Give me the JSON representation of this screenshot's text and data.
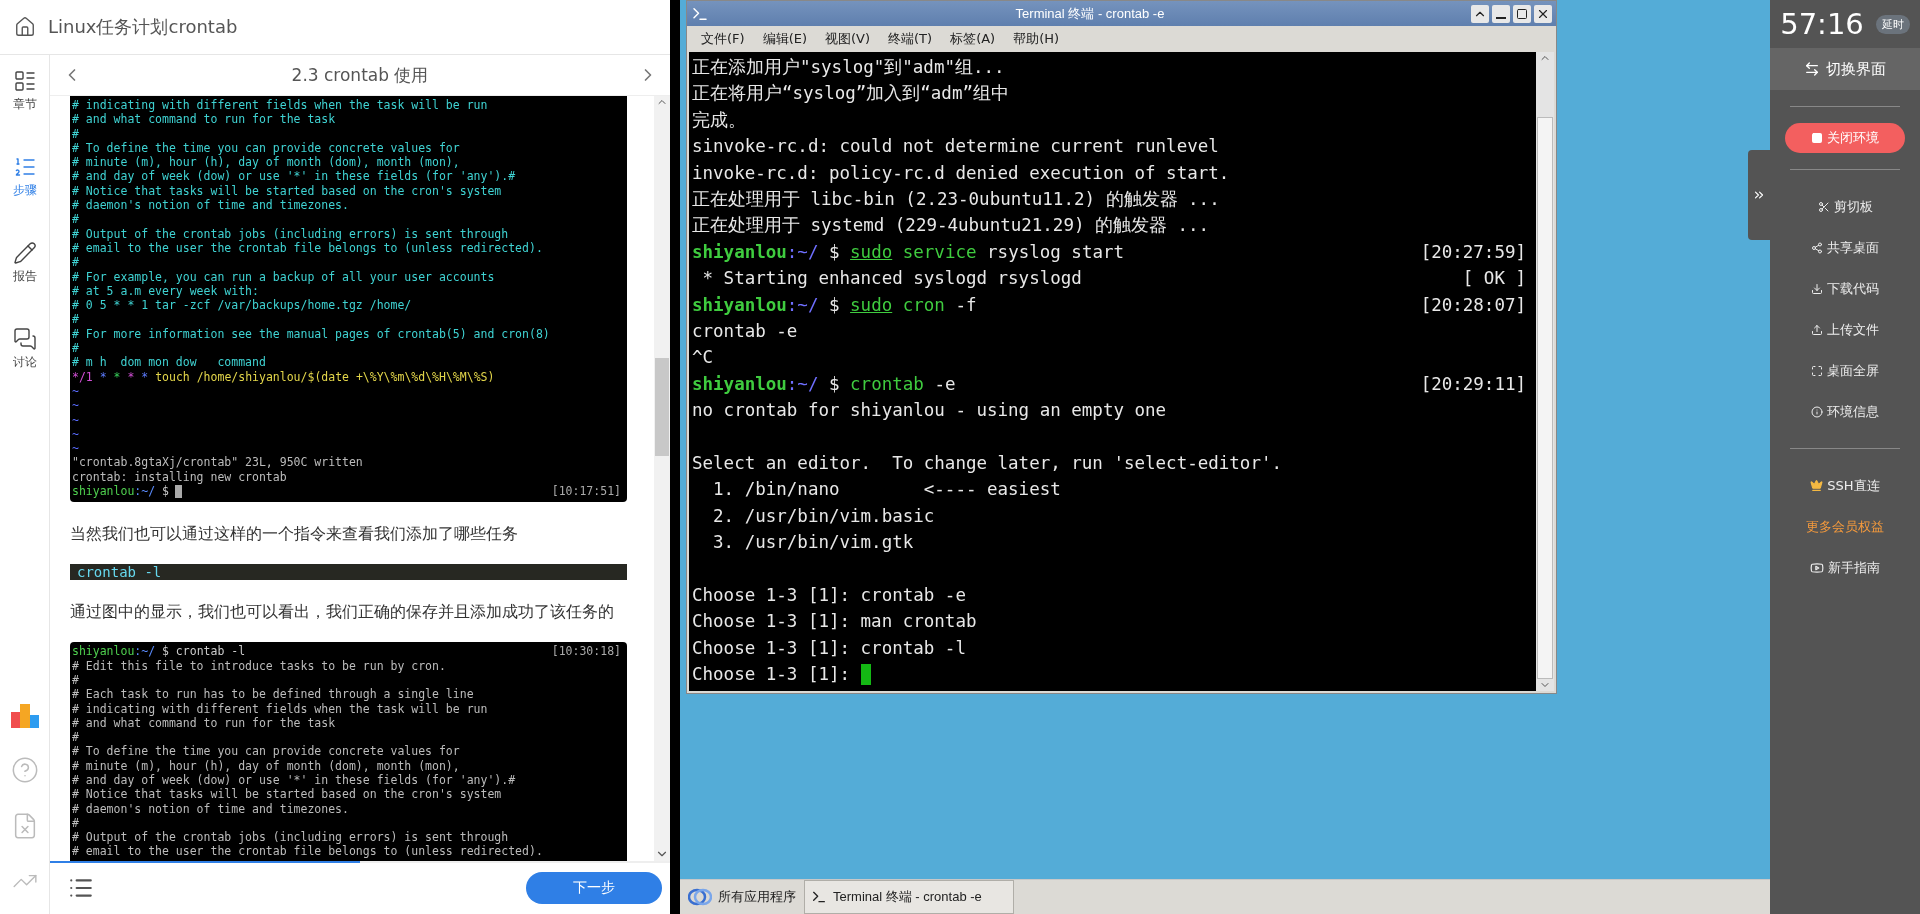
{
  "course": {
    "title": "Linux任务计划crontab"
  },
  "rail": {
    "items": [
      {
        "label": "章节",
        "selected": false
      },
      {
        "label": "步骤",
        "selected": true
      },
      {
        "label": "报告",
        "selected": false
      },
      {
        "label": "讨论",
        "selected": false
      }
    ]
  },
  "step": {
    "title": "2.3 crontab 使用"
  },
  "content": [
    {
      "kind": "image",
      "lines": [
        {
          "kind": "comment",
          "text": "# indicating with different fields when the task will be run"
        },
        {
          "kind": "comment",
          "text": "# and what command to run for the task"
        },
        {
          "kind": "comment",
          "text": "#"
        },
        {
          "kind": "comment",
          "text": "# To define the time you can provide concrete values for"
        },
        {
          "kind": "comment",
          "text": "# minute (m), hour (h), day of month (dom), month (mon),"
        },
        {
          "kind": "comment",
          "text": "# and day of week (dow) or use '*' in these fields (for 'any').#"
        },
        {
          "kind": "comment",
          "text": "# Notice that tasks will be started based on the cron's system"
        },
        {
          "kind": "comment",
          "text": "# daemon's notion of time and timezones."
        },
        {
          "kind": "comment",
          "text": "#"
        },
        {
          "kind": "comment",
          "text": "# Output of the crontab jobs (including errors) is sent through"
        },
        {
          "kind": "comment",
          "text": "# email to the user the crontab file belongs to (unless redirected)."
        },
        {
          "kind": "comment",
          "text": "#"
        },
        {
          "kind": "comment",
          "text": "# For example, you can run a backup of all your user accounts"
        },
        {
          "kind": "comment",
          "text": "# at 5 a.m every week with:"
        },
        {
          "kind": "comment",
          "text": "# 0 5 * * 1 tar -zcf /var/backups/home.tgz /home/"
        },
        {
          "kind": "comment",
          "text": "#"
        },
        {
          "kind": "comment",
          "text": "# For more information see the manual pages of crontab(5) and cron(8)"
        },
        {
          "kind": "comment",
          "text": "#"
        },
        {
          "kind": "comment",
          "text": "# m h  dom mon dow   command"
        },
        {
          "kind": "cron",
          "parts": [
            "*/1",
            "*",
            "*",
            "*",
            "*",
            "touch /home/shiyanlou/$(date +\\%Y\\%m\\%d\\%H\\%M\\%S)"
          ]
        },
        {
          "kind": "tilde",
          "text": "~"
        },
        {
          "kind": "tilde",
          "text": "~"
        },
        {
          "kind": "tilde",
          "text": "~"
        },
        {
          "kind": "tilde",
          "text": "~"
        },
        {
          "kind": "tilde",
          "text": "~"
        },
        {
          "kind": "output",
          "text": "\"crontab.8gtaXj/crontab\" 23L, 950C written"
        },
        {
          "kind": "output",
          "text": "crontab: installing new crontab"
        },
        {
          "kind": "prompt",
          "user": "shiyanlou",
          "path": ":~/",
          "command": "$",
          "time": "[10:17:51]",
          "cursor": true
        }
      ]
    },
    {
      "kind": "paragraph",
      "text": "当然我们也可以通过这样的一个指令来查看我们添加了哪些任务"
    },
    {
      "kind": "code",
      "text": "crontab -l"
    },
    {
      "kind": "paragraph",
      "text": "通过图中的显示，我们也可以看出，我们正确的保存并且添加成功了该任务的"
    },
    {
      "kind": "image",
      "lines": [
        {
          "kind": "prompt",
          "user": "shiyanlou",
          "path": ":~/",
          "command": "$ crontab -l",
          "time": "[10:30:18]"
        },
        {
          "kind": "output",
          "text": "# Edit this file to introduce tasks to be run by cron."
        },
        {
          "kind": "output",
          "text": "#"
        },
        {
          "kind": "output",
          "text": "# Each task to run has to be defined through a single line"
        },
        {
          "kind": "output",
          "text": "# indicating with different fields when the task will be run"
        },
        {
          "kind": "output",
          "text": "# and what command to run for the task"
        },
        {
          "kind": "output",
          "text": "#"
        },
        {
          "kind": "output",
          "text": "# To define the time you can provide concrete values for"
        },
        {
          "kind": "output",
          "text": "# minute (m), hour (h), day of month (dom), month (mon),"
        },
        {
          "kind": "output",
          "text": "# and day of week (dow) or use '*' in these fields (for 'any').#"
        },
        {
          "kind": "output",
          "text": "# Notice that tasks will be started based on the cron's system"
        },
        {
          "kind": "output",
          "text": "# daemon's notion of time and timezones."
        },
        {
          "kind": "output",
          "text": "#"
        },
        {
          "kind": "output",
          "text": "# Output of the crontab jobs (including errors) is sent through"
        },
        {
          "kind": "output",
          "text": "# email to the user the crontab file belongs to (unless redirected)."
        }
      ]
    }
  ],
  "footer": {
    "progress": {
      "level": 0.5
    },
    "next_button": "下一步"
  },
  "terminal": {
    "title": "Terminal 终端 - crontab -e",
    "menu": [
      "文件(F)",
      "编辑(E)",
      "视图(V)",
      "终端(T)",
      "标签(A)",
      "帮助(H)"
    ],
    "lines": [
      {
        "kind": "text",
        "text": "正在添加用户\"syslog\"到\"adm\"组..."
      },
      {
        "kind": "text",
        "text": "正在将用户“syslog”加入到“adm”组中"
      },
      {
        "kind": "text",
        "text": "完成。"
      },
      {
        "kind": "text",
        "text": "sinvoke-rc.d: could not determine current runlevel"
      },
      {
        "kind": "text",
        "text": "invoke-rc.d: policy-rc.d denied execution of start."
      },
      {
        "kind": "text",
        "text": "正在处理用于 libc-bin (2.23-0ubuntu11.2) 的触发器 ..."
      },
      {
        "kind": "text",
        "text": "正在处理用于 systemd (229-4ubuntu21.29) 的触发器 ..."
      },
      {
        "kind": "prompt",
        "user": "shiyanlou",
        "path": ":~/",
        "sign": "$",
        "command": [
          {
            "text": "sudo",
            "kind": "sudo"
          },
          {
            "text": "service",
            "kind": "command"
          },
          {
            "text": "rsyslog start",
            "kind": "arg"
          }
        ],
        "time": "[20:27:59]"
      },
      {
        "kind": "status",
        "text": " * Starting enhanced syslogd rsyslogd",
        "result": "[ OK ]"
      },
      {
        "kind": "prompt",
        "user": "shiyanlou",
        "path": ":~/",
        "sign": "$",
        "command": [
          {
            "text": "sudo",
            "kind": "sudo"
          },
          {
            "text": "cron",
            "kind": "command"
          },
          {
            "text": "-f",
            "kind": "arg"
          }
        ],
        "time": "[20:28:07]"
      },
      {
        "kind": "text",
        "text": "crontab -e"
      },
      {
        "kind": "text",
        "text": "^C"
      },
      {
        "kind": "prompt",
        "user": "shiyanlou",
        "path": ":~/",
        "sign": "$",
        "command": [
          {
            "text": "crontab",
            "kind": "command"
          },
          {
            "text": "-e",
            "kind": "arg"
          }
        ],
        "time": "[20:29:11]"
      },
      {
        "kind": "text",
        "text": "no crontab for shiyanlou - using an empty one"
      },
      {
        "kind": "blank"
      },
      {
        "kind": "text",
        "text": "Select an editor.  To change later, run 'select-editor'."
      },
      {
        "kind": "text",
        "text": "  1. /bin/nano        <---- easiest"
      },
      {
        "kind": "text",
        "text": "  2. /usr/bin/vim.basic"
      },
      {
        "kind": "text",
        "text": "  3. /usr/bin/vim.gtk"
      },
      {
        "kind": "blank"
      },
      {
        "kind": "text",
        "text": "Choose 1-3 [1]: crontab -e"
      },
      {
        "kind": "text",
        "text": "Choose 1-3 [1]: man crontab"
      },
      {
        "kind": "text",
        "text": "Choose 1-3 [1]: crontab -l"
      },
      {
        "kind": "input",
        "text": "Choose 1-3 [1]:",
        "cursor": true
      }
    ]
  },
  "taskbar": {
    "start": "所有应用程序",
    "tasks": [
      {
        "label": "Terminal 终端 - crontab -e",
        "selected": true
      }
    ]
  },
  "side_panel": {
    "timer": "57:16",
    "extend": "延时",
    "switch": "切换界面",
    "close": "关闭环境",
    "tools": [
      "剪切板",
      "共享桌面",
      "下载代码",
      "上传文件",
      "桌面全屏",
      "环境信息"
    ],
    "member": {
      "ssh": "SSH直连",
      "more": "更多会员权益",
      "guide": "新手指南"
    }
  }
}
